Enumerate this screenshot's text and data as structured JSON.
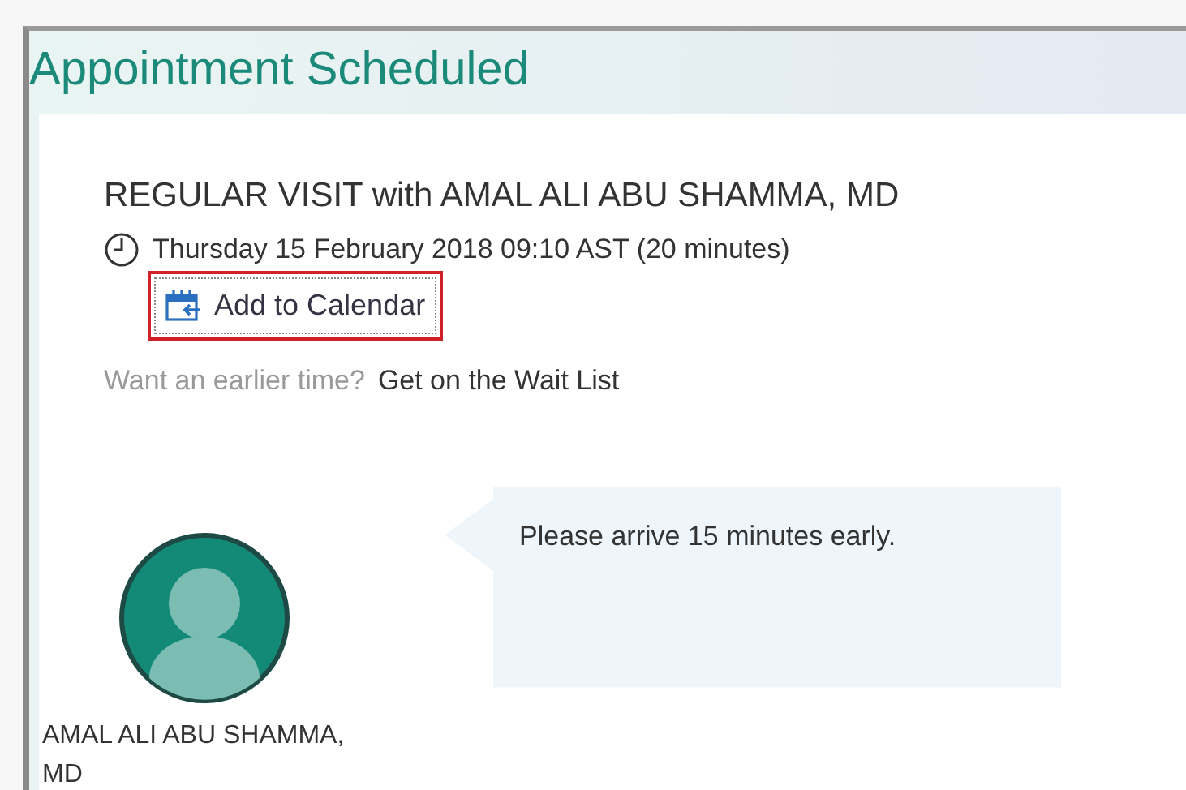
{
  "page": {
    "title": "Appointment Scheduled"
  },
  "appointment": {
    "heading": "REGULAR VISIT with AMAL ALI ABU SHAMMA, MD",
    "datetime": "Thursday 15 February 2018 09:10 AST (20 minutes)",
    "add_to_calendar": {
      "label": "Add to Calendar",
      "highlighted": true
    },
    "wait_list": {
      "prompt": "Want an earlier time?",
      "link": "Get on the Wait List"
    }
  },
  "provider": {
    "name": "AMAL ALI ABU SHAMMA, MD",
    "message": "Please arrive 15 minutes early."
  }
}
